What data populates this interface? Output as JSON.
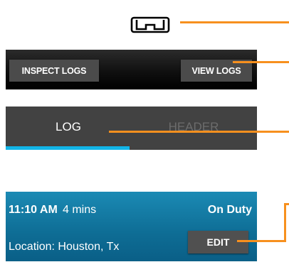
{
  "colors": {
    "callout": "#f7901e",
    "tab_indicator": "#12b5e8",
    "status_panel": "#0e6d95",
    "toolbar": "#101010",
    "tabs_panel": "#424242"
  },
  "logo": {
    "icon": "bracket-logo-icon"
  },
  "toolbar": {
    "inspect_logs_label": "INSPECT LOGS",
    "view_logs_label": "VIEW LOGS"
  },
  "tabs": [
    {
      "label": "LOG",
      "selected": true
    },
    {
      "label": "HEADER",
      "selected": false
    }
  ],
  "status": {
    "time": "11:10 AM",
    "duration": "4 mins",
    "duty": "On Duty",
    "location": "Location:  Houston, Tx",
    "edit_label": "EDIT"
  }
}
